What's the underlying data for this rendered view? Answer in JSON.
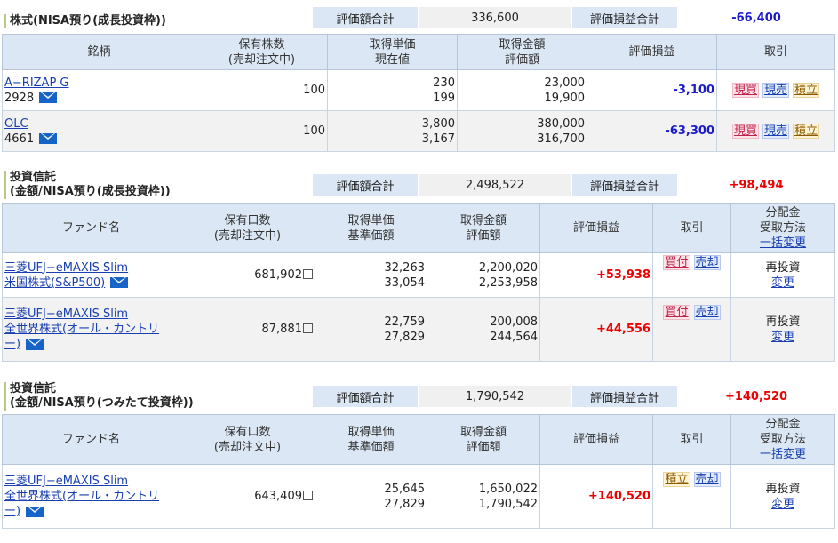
{
  "stocks": {
    "title": "株式(NISA預り(成長投資枠))",
    "eval_total_label": "評価額合計",
    "eval_total_value": "336,600",
    "pl_total_label": "評価損益合計",
    "pl_total_value": "-66,400",
    "headers": {
      "name": "銘柄",
      "holding": "保有株数",
      "holding2": "(売却注文中)",
      "unit": "取得単価",
      "unit2": "現在値",
      "amount": "取得金額",
      "amount2": "評価額",
      "pl": "評価損益",
      "trade": "取引"
    },
    "rows": [
      {
        "name": "A−RIZAP G",
        "code": "2928",
        "shares": "100",
        "unit_cost": "230",
        "current": "199",
        "cost": "23,000",
        "value": "19,900",
        "pl": "-3,100",
        "btn1": "現買",
        "btn2": "現売",
        "btn3": "積立"
      },
      {
        "name": "OLC",
        "code": "4661",
        "shares": "100",
        "unit_cost": "3,800",
        "current": "3,167",
        "cost": "380,000",
        "value": "316,700",
        "pl": "-63,300",
        "btn1": "現買",
        "btn2": "現売",
        "btn3": "積立"
      }
    ]
  },
  "fund1": {
    "title1": "投資信託",
    "title2": "(金額/NISA預り(成長投資枠))",
    "eval_total_label": "評価額合計",
    "eval_total_value": "2,498,522",
    "pl_total_label": "評価損益合計",
    "pl_total_value": "+98,494",
    "headers": {
      "name": "ファンド名",
      "holding": "保有口数",
      "holding2": "(売却注文中)",
      "unit": "取得単価",
      "unit2": "基準価額",
      "amount": "取得金額",
      "amount2": "評価額",
      "pl": "評価損益",
      "trade": "取引",
      "dist1": "分配金",
      "dist2": "受取方法",
      "dist3": "一括変更"
    },
    "rows": [
      {
        "name1": "三菱UFJ−eMAXIS Slim ",
        "name2": "米国株式(S&P500)",
        "units": "681,902",
        "unit_cost": "32,263",
        "nav": "33,054",
        "cost": "2,200,020",
        "value": "2,253,958",
        "pl": "+53,938",
        "btn1": "買付",
        "btn2": "売却",
        "dist": "再投資",
        "change": "変更"
      },
      {
        "name1": "三菱UFJ−eMAXIS Slim ",
        "name2": "全世界株式(オール・カントリ",
        "name3": "ー)",
        "units": "87,881",
        "unit_cost": "22,759",
        "nav": "27,829",
        "cost": "200,008",
        "value": "244,564",
        "pl": "+44,556",
        "btn1": "買付",
        "btn2": "売却",
        "dist": "再投資",
        "change": "変更"
      }
    ]
  },
  "fund2": {
    "title1": "投資信託",
    "title2": "(金額/NISA預り(つみたて投資枠))",
    "eval_total_label": "評価額合計",
    "eval_total_value": "1,790,542",
    "pl_total_label": "評価損益合計",
    "pl_total_value": "+140,520",
    "headers": {
      "name": "ファンド名",
      "holding": "保有口数",
      "holding2": "(売却注文中)",
      "unit": "取得単価",
      "unit2": "基準価額",
      "amount": "取得金額",
      "amount2": "評価額",
      "pl": "評価損益",
      "trade": "取引",
      "dist1": "分配金",
      "dist2": "受取方法",
      "dist3": "一括変更"
    },
    "rows": [
      {
        "name1": "三菱UFJ−eMAXIS Slim ",
        "name2": "全世界株式(オール・カントリ",
        "name3": "ー)",
        "units": "643,409",
        "unit_cost": "25,645",
        "nav": "27,829",
        "cost": "1,650,022",
        "value": "1,790,542",
        "pl": "+140,520",
        "btn1": "積立",
        "btn2": "売却",
        "dist": "再投資",
        "change": "変更"
      }
    ]
  },
  "icons": {
    "mail": "mail-icon",
    "checkbox": "checkbox-square-icon"
  },
  "colors": {
    "negative": "#1a1acc",
    "positive": "#e00000",
    "header_bg": "#dbe7f4"
  }
}
